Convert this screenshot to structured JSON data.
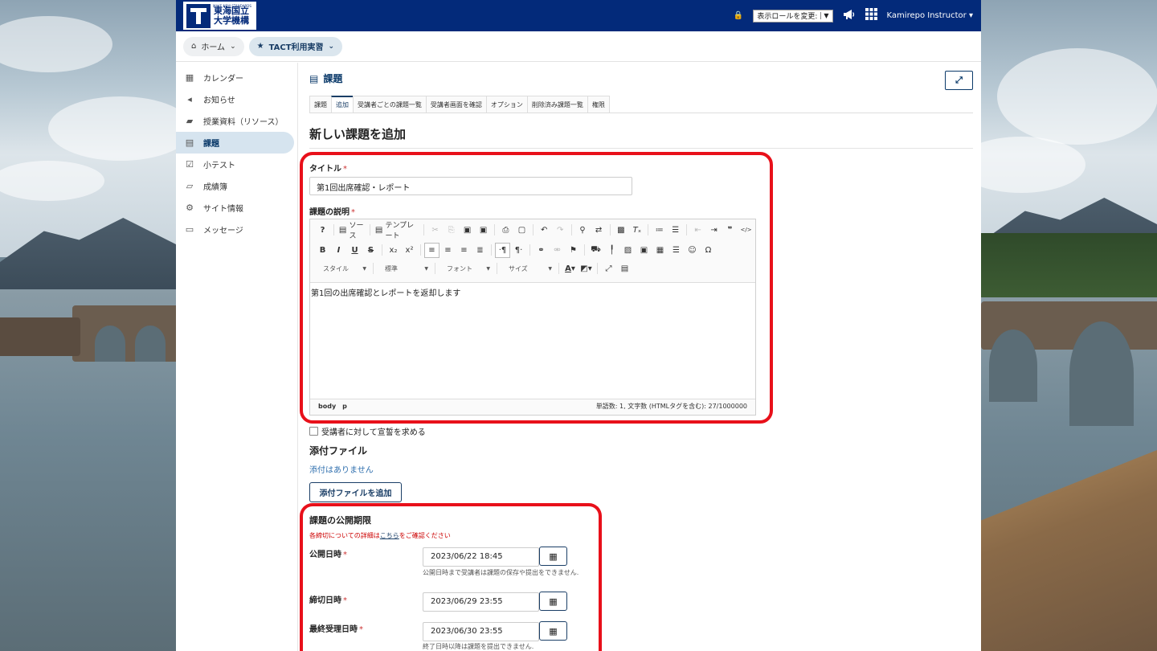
{
  "brand": {
    "logo_text_1": "東海国立",
    "logo_text_2": "大学機構",
    "logo_tagline": "MAKE NEW STANDARDS"
  },
  "topbar": {
    "role_select_value": "表示ロールを変更:",
    "announce_icon": "bullhorn-icon",
    "apps_icon": "grid-icon",
    "user_name": "Kamirepo Instructor"
  },
  "breadcrumb": {
    "home": "ホーム",
    "site": "TACT利用実習"
  },
  "sidebar": {
    "items": [
      {
        "label": "カレンダー",
        "icon": "calendar-icon"
      },
      {
        "label": "お知らせ",
        "icon": "bullhorn-icon"
      },
      {
        "label": "授業資料（リソース）",
        "icon": "folder-icon"
      },
      {
        "label": "課題",
        "icon": "file-icon",
        "active": true
      },
      {
        "label": "小テスト",
        "icon": "checkbox-icon"
      },
      {
        "label": "成績簿",
        "icon": "book-icon"
      },
      {
        "label": "サイト情報",
        "icon": "gear-icon"
      },
      {
        "label": "メッセージ",
        "icon": "inbox-icon"
      }
    ]
  },
  "tool": {
    "title": "課題",
    "tabs": [
      "課題",
      "追加",
      "受講者ごとの課題一覧",
      "受講者画面を確認",
      "オプション",
      "削除済み課題一覧",
      "権限"
    ],
    "active_tab": "追加",
    "page_heading": "新しい課題を追加"
  },
  "form": {
    "title_label": "タイトル",
    "title_value": "第1回出席確認・レポート",
    "description_label": "課題の説明",
    "editor": {
      "source_label": "ソース",
      "template_label": "テンプレート",
      "style_combo": "スタイル",
      "format_combo": "標準",
      "font_combo": "フォント",
      "size_combo": "サイズ",
      "body_text": "第1回の出席確認とレポートを返却します",
      "path_body": "body",
      "path_p": "p",
      "word_count": "単語数: 1, 文字数 (HTMLタグを含む): 27/1000000"
    },
    "honor_pledge_label": "受講者に対して宣誓を求める",
    "attachments_heading": "添付ファイル",
    "no_attachments": "添付はありません",
    "add_attachment_button": "添付ファイルを追加",
    "schedule_heading": "課題の公開期限",
    "schedule_note_prefix": "各締切についての詳細は",
    "schedule_note_link": "こちら",
    "schedule_note_suffix": "をご確認ください",
    "open_date_label": "公開日時",
    "open_date_value": "2023/06/22 18:45",
    "open_date_help": "公開日時まで受講者は課題の保存や提出をできません.",
    "due_date_label": "締切日時",
    "due_date_value": "2023/06/29 23:55",
    "accept_until_label": "最終受理日時",
    "accept_until_value": "2023/06/30 23:55",
    "accept_until_help": "終了日時以降は課題を提出できません."
  },
  "annotation_color": "#e8101a"
}
